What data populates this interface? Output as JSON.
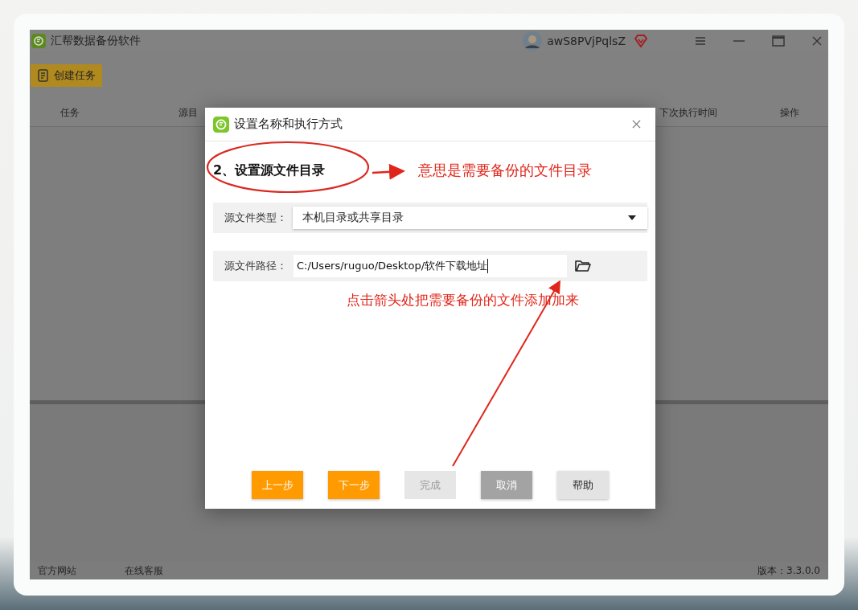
{
  "app": {
    "title": "汇帮数据备份软件",
    "user": "awS8PVjPqlsZ",
    "create_button": "创建任务",
    "table": {
      "columns": [
        "任务",
        "源目",
        "下次执行时间",
        "操作"
      ]
    },
    "status_bar": [
      "官方网站",
      "在线客服",
      "版本：3.3.0.0"
    ]
  },
  "dialog": {
    "title": "设置名称和执行方式",
    "heading": "2、设置源文件目录",
    "fields": [
      {
        "kind": "dropdown",
        "label": "源文件类型：",
        "value": "本机目录或共享目录"
      },
      {
        "kind": "path",
        "label": "源文件路径：",
        "value": "C:/Users/ruguo/Desktop/软件下载地址"
      }
    ],
    "buttons": [
      {
        "label": "上一步",
        "kind": "primary",
        "disabled": false
      },
      {
        "label": "下一步",
        "kind": "primary",
        "disabled": false
      },
      {
        "label": "完成",
        "kind": "plain",
        "disabled": true
      },
      {
        "label": "取消",
        "kind": "dark",
        "disabled": false
      },
      {
        "label": "帮助",
        "kind": "light",
        "disabled": false
      }
    ]
  },
  "annotations": [
    "意思是需要备份的文件目录",
    "点击箭头处把需要备份的文件添加加来"
  ]
}
